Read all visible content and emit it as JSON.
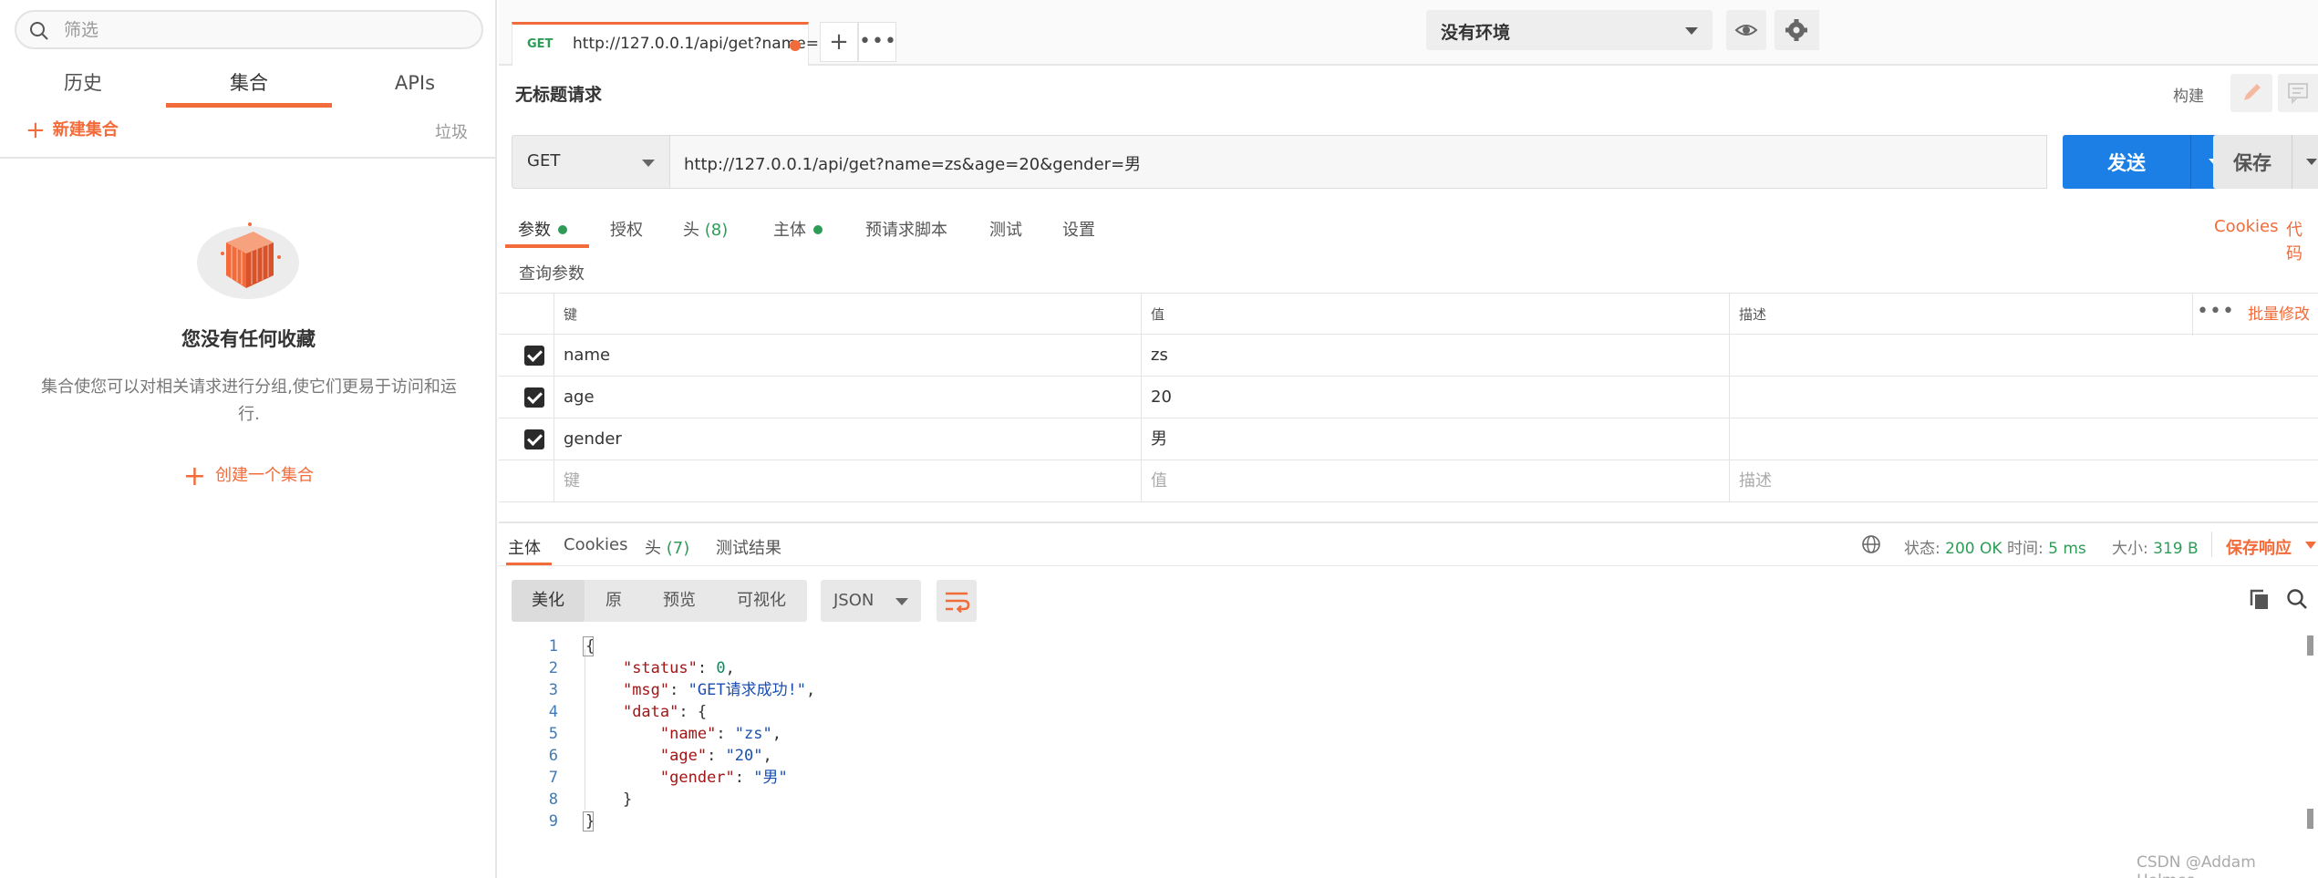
{
  "sidebar": {
    "search_placeholder": "筛选",
    "tabs": [
      {
        "label": "历史"
      },
      {
        "label": "集合"
      },
      {
        "label": "APIs"
      }
    ],
    "new_collection_label": "新建集合",
    "trash_label": "垃圾",
    "empty_title": "您没有任何收藏",
    "empty_desc": "集合使您可以对相关请求进行分组,使它们更易于访问和运行.",
    "create_collection_label": "创建一个集合"
  },
  "topbar": {
    "tab_method": "GET",
    "tab_url": "http://127.0.0.1/api/get?name=...",
    "environment": "没有环境"
  },
  "request": {
    "title": "无标题请求",
    "build_label": "构建",
    "method": "GET",
    "url": "http://127.0.0.1/api/get?name=zs&age=20&gender=男",
    "send_label": "发送",
    "save_label": "保存"
  },
  "param_tabs": {
    "params": "参数",
    "auth": "授权",
    "headers": "头",
    "headers_count": "(8)",
    "body": "主体",
    "prerequest": "预请求脚本",
    "tests": "测试",
    "settings": "设置",
    "cookies": "Cookies",
    "code": "代码"
  },
  "query_params": {
    "label": "查询参数",
    "headers": {
      "key": "键",
      "value": "值",
      "description": "描述"
    },
    "bulk_edit": "批量修改",
    "rows": [
      {
        "key": "name",
        "value": "zs",
        "checked": true
      },
      {
        "key": "age",
        "value": "20",
        "checked": true
      },
      {
        "key": "gender",
        "value": "男",
        "checked": true
      }
    ],
    "placeholder": {
      "key": "键",
      "value": "值",
      "description": "描述"
    }
  },
  "response": {
    "tabs": {
      "body": "主体",
      "cookies": "Cookies",
      "headers": "头",
      "headers_count": "(7)",
      "test_results": "测试结果"
    },
    "status_label": "状态:",
    "status_value": "200 OK",
    "time_label": "时间:",
    "time_value": "5 ms",
    "size_label": "大小:",
    "size_value": "319 B",
    "save_response": "保存响应",
    "view_modes": [
      "美化",
      "原",
      "预览",
      "可视化"
    ],
    "format": "JSON",
    "line_numbers": [
      "1",
      "2",
      "3",
      "4",
      "5",
      "6",
      "7",
      "8",
      "9"
    ]
  },
  "watermark": "CSDN @Addam Holmes",
  "colors": {
    "accent": "#f26b3a",
    "send": "#1b7fe6",
    "success": "#2e9c57"
  }
}
